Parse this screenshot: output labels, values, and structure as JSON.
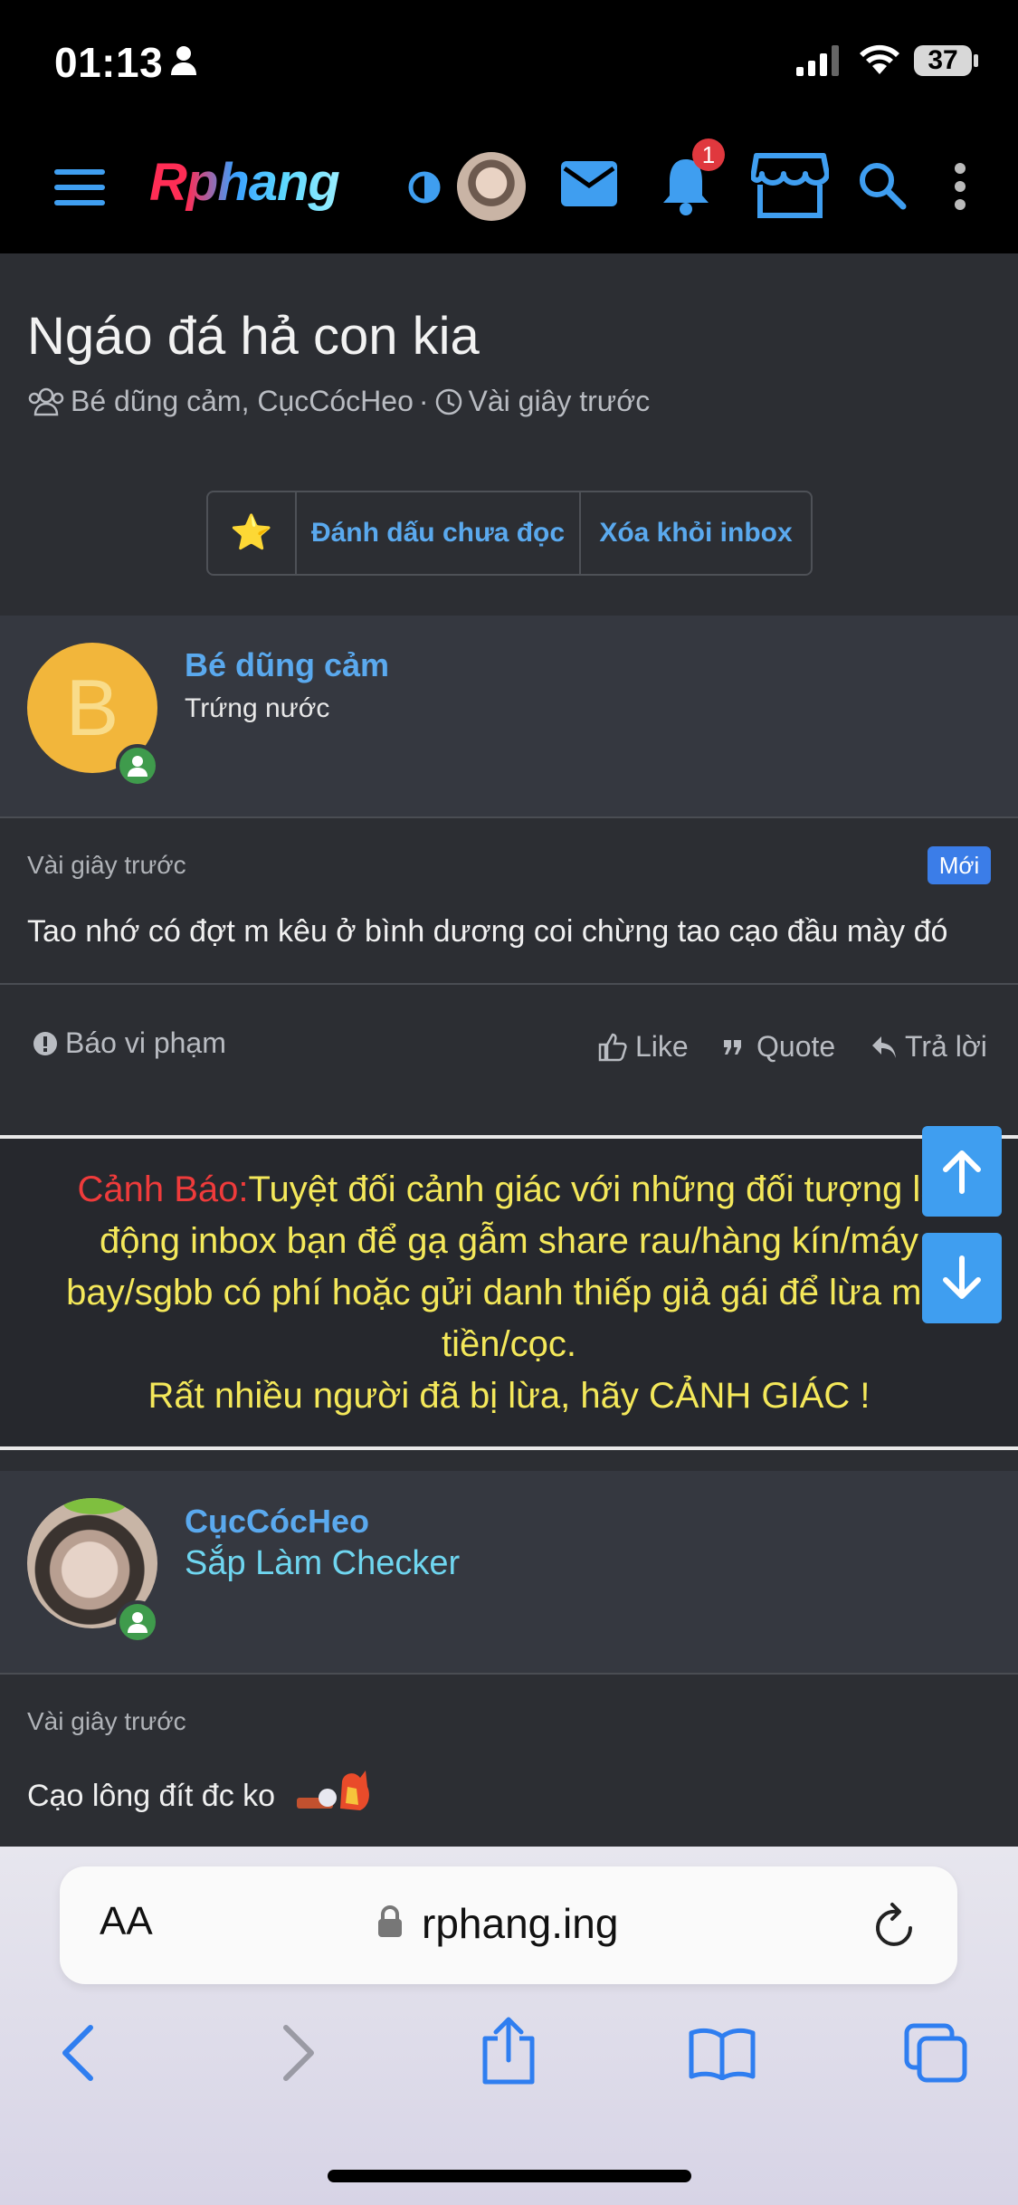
{
  "status_bar": {
    "time": "01:13",
    "battery": "37"
  },
  "app_header": {
    "logo": "Rphang",
    "notification_count": "1",
    "icons": [
      "menu-icon",
      "theme-toggle-icon",
      "avatar",
      "mail-icon",
      "bell-icon",
      "store-icon",
      "search-icon",
      "more-vertical-icon"
    ]
  },
  "conversation": {
    "title": "Ngáo đá hả con kia",
    "participants": "Bé dũng cảm, CụcCócHeo",
    "separator": "·",
    "time": "Vài giây trước",
    "buttons": {
      "star": "⭐",
      "mark_unread": "Đánh dấu chưa đọc",
      "remove_inbox": "Xóa khỏi inbox"
    }
  },
  "messages": [
    {
      "avatar_letter": "B",
      "username": "Bé dũng cảm",
      "user_title": "Trứng nước",
      "timestamp": "Vài giây trước",
      "new_label": "Mới",
      "text": "Tao nhớ có đợt m kêu ở bình dương coi chừng tao cạo đầu mày đó",
      "report": "Báo vi phạm",
      "like": "Like",
      "quote": "Quote",
      "reply": "Trả lời"
    },
    {
      "username": "CụcCócHeo",
      "user_title": "Sắp Làm Checker",
      "timestamp": "Vài giây trước",
      "text": "Cạo lông đít đc ko"
    }
  ],
  "warning": {
    "label": "Cảnh Báo:",
    "line1": "Tuyệt đối cảnh giác với những đối tượng lạ",
    "line2": "động inbox bạn để gạ gẫm share rau/hàng kín/máy",
    "line3": "bay/sgbb có phí hoặc gửi danh thiếp giả gái để lừa mất",
    "line4": "tiền/cọc.",
    "line5": "Rất nhiều người đã bị lừa, hãy CẢNH GIÁC !"
  },
  "safari": {
    "text_size": "AA",
    "url": "rphang.ing"
  },
  "colors": {
    "link": "#5aa9ee",
    "warning_text": "#f4e85a",
    "warning_label": "#ef3b3b",
    "badge_new": "#3b7de8",
    "title_cyan": "#6fd6f0"
  }
}
